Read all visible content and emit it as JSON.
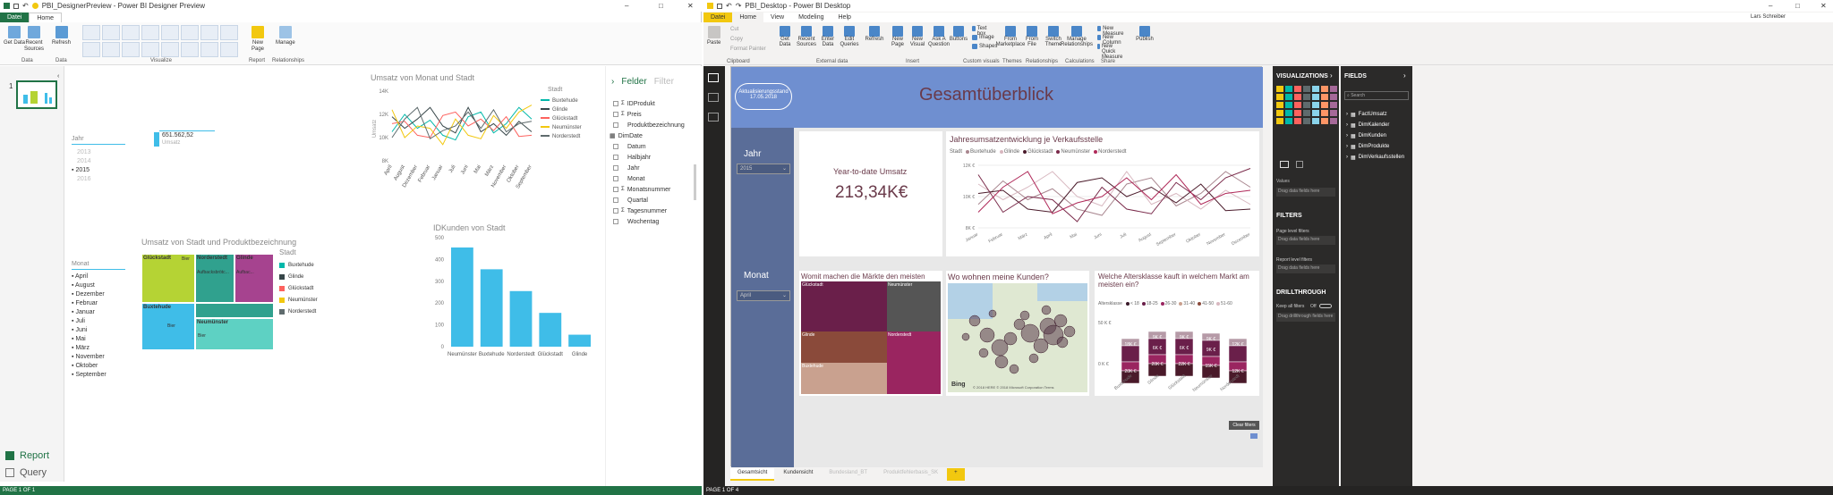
{
  "left": {
    "title": "PBI_DesignerPreview - Power BI Designer Preview",
    "tabs": [
      "Datei",
      "Home"
    ],
    "ribbon": {
      "buttons": [
        {
          "label": "Get Data",
          "group": "Data"
        },
        {
          "label": "Recent Sources",
          "group": "Data"
        },
        {
          "label": "Refresh",
          "group": "Data"
        },
        {
          "label": "New Page",
          "group": "Report"
        },
        {
          "label": "Manage",
          "group": "Relationships"
        }
      ],
      "groups": [
        "Data",
        "Visualize",
        "Report",
        "Relationships"
      ]
    },
    "page_thumb_number": "1",
    "nav": {
      "report": "Report",
      "query": "Query"
    },
    "status": "PAGE 1 OF 1",
    "card": {
      "value": "651.562,52",
      "label": "Umsatz"
    },
    "slicer_jahr": {
      "title": "Jahr",
      "items": [
        {
          "label": "2013",
          "dim": true
        },
        {
          "label": "2014",
          "dim": true
        },
        {
          "label": "2015",
          "dim": false
        },
        {
          "label": "2016",
          "dim": true
        }
      ]
    },
    "slicer_monat": {
      "title": "Monat",
      "items": [
        "April",
        "August",
        "Dezember",
        "Februar",
        "Januar",
        "Juli",
        "Juni",
        "Mai",
        "März",
        "November",
        "Oktober",
        "September"
      ]
    },
    "line_chart": {
      "title": "Umsatz von Monat und Stadt",
      "ylabel": "Umsatz"
    },
    "treemap": {
      "title": "Umsatz von Stadt und Produktbezeichnung",
      "legend_title": "Stadt",
      "tiles": [
        {
          "label": "Glückstadt",
          "sub": "Bier"
        },
        {
          "label": "Norderstedt",
          "sub": "Aufbacksbrötc..."
        },
        {
          "label": "Glinde",
          "sub": "Aufbac..."
        },
        {
          "label": "Buxtehude",
          "sub": "Bier"
        },
        {
          "label": "Neumünster",
          "sub": "Bier"
        }
      ]
    },
    "bar_chart": {
      "title": "IDKunden von Stadt"
    },
    "fields": {
      "tab_felder": "Felder",
      "tab_filter": "Filter",
      "items": [
        {
          "label": "IDProdukt",
          "sigma": true
        },
        {
          "label": "Preis",
          "sigma": true
        },
        {
          "label": "Produktbezeichnung",
          "sigma": false
        }
      ],
      "table": "DimDate",
      "date_items": [
        {
          "label": "Datum",
          "sigma": false
        },
        {
          "label": "Halbjahr",
          "sigma": false
        },
        {
          "label": "Jahr",
          "sigma": false
        },
        {
          "label": "Monat",
          "sigma": false
        },
        {
          "label": "Monatsnummer",
          "sigma": true
        },
        {
          "label": "Quartal",
          "sigma": false
        },
        {
          "label": "Tagesnummer",
          "sigma": true
        },
        {
          "label": "Wochentag",
          "sigma": false
        }
      ]
    }
  },
  "right": {
    "title": "PBI_Desktop - Power BI Desktop",
    "tabs": [
      "Datei",
      "Home",
      "View",
      "Modeling",
      "Help"
    ],
    "user": "Lars Schreiber",
    "clipboard": [
      "Paste",
      "Cut",
      "Copy",
      "Format Painter"
    ],
    "ribbon_buttons": [
      "Get Data",
      "Recent Sources",
      "Enter Data",
      "Edit Queries",
      "Refresh",
      "New Page",
      "New Visual",
      "Ask A Question",
      "Buttons",
      "Text box",
      "Image",
      "Shapes",
      "From Marketplace",
      "From File",
      "Switch Theme",
      "Manage Relationships",
      "New Measure",
      "New Column",
      "New Quick Measure",
      "Publish"
    ],
    "groups": [
      "Clipboard",
      "External data",
      "Insert",
      "Custom visuals",
      "Themes",
      "Relationships",
      "Calculations",
      "Share"
    ],
    "report_title": "Gesamtüberblick",
    "refresh_badge": {
      "line1": "Aktualisierungsstand",
      "line2": "17.05.2018"
    },
    "jahr": {
      "title": "Jahr",
      "value": "2015"
    },
    "monat": {
      "title": "Monat",
      "value": "April"
    },
    "kpi": {
      "title": "Year-to-date Umsatz",
      "value": "213,34K€"
    },
    "line": {
      "title": "Jahresumsatzentwicklung je Verkaufsstelle",
      "legend_title": "Stadt"
    },
    "tree": {
      "title": "Womit machen die Märkte den meisten Umsatz?"
    },
    "map": {
      "title": "Wo wohnen meine Kunden?",
      "bing": "Bing",
      "copy": "© 2018 HERE © 2018 Microsoft Corporation Terms"
    },
    "age": {
      "title": "Welche Altersklasse kauft in welchem Markt am meisten ein?",
      "legend_label": "Altersklasse",
      "ylab1": "50 K €",
      "ylab2": "0 K €"
    },
    "tabs_bottom": [
      "Gesamtsicht",
      "Kundensicht",
      "Bundesland_BT",
      "Produktfehlerbasis_SK",
      "+"
    ],
    "clear_btn": "Clear filters",
    "status": "PAGE 1 OF 4",
    "vis_pane": {
      "title": "VISUALIZATIONS",
      "values": "Values",
      "drag": "Drag data fields here",
      "filters": "FILTERS",
      "page_filters": "Page level filters",
      "report_filters": "Report level filters",
      "drill": "DRILLTHROUGH",
      "keep": "Keep all filters",
      "off": "Off",
      "drill_drag": "Drag drillthrough fields here"
    },
    "fields_pane": {
      "title": "FIELDS",
      "search": "Search",
      "tables": [
        "FactUmsatz",
        "DimKalender",
        "DimKunden",
        "DimProdukte",
        "DimVerkaufsstellen"
      ]
    }
  },
  "chart_data": [
    {
      "type": "line",
      "title": "Umsatz von Monat und Stadt",
      "ylabel": "Umsatz",
      "ylim": [
        8000,
        14000
      ],
      "yticks": [
        "8K",
        "10K",
        "12K",
        "14K"
      ],
      "categories": [
        "April",
        "August",
        "Dezember",
        "Februar",
        "Januar",
        "Juli",
        "Juni",
        "Mai",
        "März",
        "November",
        "Oktober",
        "September"
      ],
      "legend_title": "Stadt",
      "series": [
        {
          "name": "Buxtehude",
          "color": "#01b8aa",
          "values": [
            10500,
            12000,
            10800,
            11500,
            10200,
            9800,
            11800,
            12200,
            10400,
            11200,
            12600,
            11600
          ]
        },
        {
          "name": "Glinde",
          "color": "#374649",
          "values": [
            11800,
            10800,
            11600,
            12600,
            11000,
            10400,
            12600,
            10500,
            11200,
            10200,
            11400,
            10500
          ]
        },
        {
          "name": "Glückstadt",
          "color": "#fd625e",
          "values": [
            11200,
            11400,
            10200,
            10000,
            11900,
            12200,
            11000,
            11600,
            10600,
            11800,
            10100,
            10200
          ]
        },
        {
          "name": "Neumünster",
          "color": "#f2c80f",
          "values": [
            12400,
            10000,
            11000,
            10800,
            9400,
            11600,
            10200,
            9900,
            11900,
            10800,
            12200,
            12800
          ]
        },
        {
          "name": "Norderstedt",
          "color": "#5f6b6d",
          "values": [
            10000,
            11600,
            12600,
            9900,
            10600,
            11000,
            12200,
            10800,
            12400,
            10500,
            11200,
            11400
          ]
        }
      ]
    },
    {
      "type": "bar",
      "title": "IDKunden von Stadt",
      "ylim": [
        0,
        500
      ],
      "yticks": [
        "0",
        "100",
        "200",
        "300",
        "400",
        "500"
      ],
      "categories": [
        "Neumünster",
        "Buxtehude",
        "Norderstedt",
        "Glückstadt",
        "Glinde"
      ],
      "values": [
        455,
        355,
        255,
        155,
        55
      ],
      "color": "#3fbde8"
    },
    {
      "type": "bar",
      "title": "Welche Altersklasse kauft in welchem Markt am meisten ein?",
      "legend": [
        "< 18",
        "18-25",
        "26-30",
        "31-40",
        "41-50",
        "51-60"
      ],
      "categories": [
        "Buxtehude",
        "Glinde",
        "Glückstadt",
        "Neumünster",
        "Norderstedt"
      ],
      "labels_top": [
        "18K €",
        "9K €",
        "9K €",
        "9K €",
        "12K €"
      ],
      "labels_mid": [
        "",
        "6K €",
        "6K €",
        "9K €",
        ""
      ],
      "labels_bot": [
        "20K €",
        "20K €",
        "22K €",
        "15K €",
        "12K €"
      ]
    }
  ]
}
